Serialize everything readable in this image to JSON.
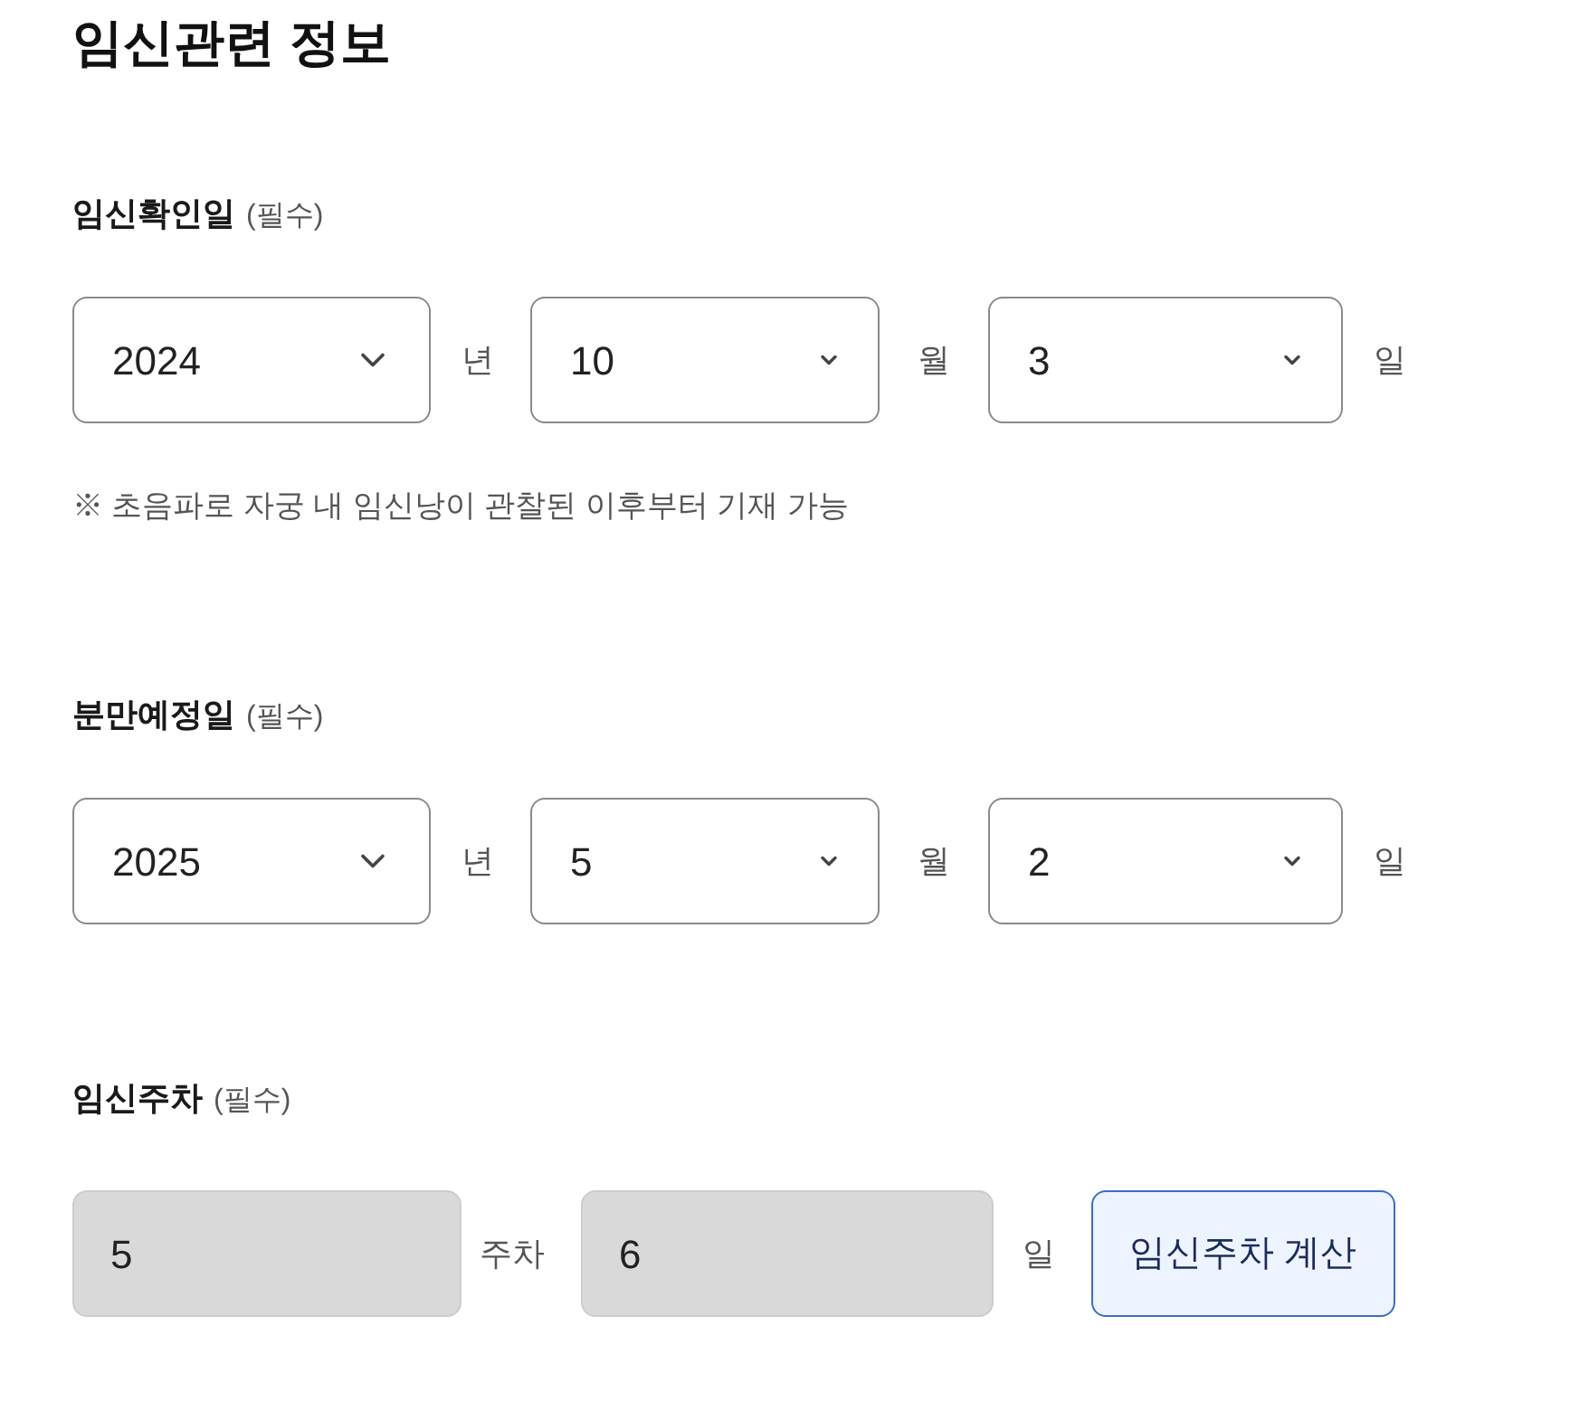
{
  "heading": "임신관련 정보",
  "sections": [
    {
      "kind": "date",
      "label": "임신확인일",
      "required_note": "(필수)",
      "year": "2024",
      "year_unit": "년",
      "month": "10",
      "month_unit": "월",
      "day": "3",
      "day_unit": "일",
      "note": "※ 초음파로 자궁 내 임신낭이 관찰된 이후부터 기재 가능"
    },
    {
      "kind": "date",
      "label": "분만예정일",
      "required_note": "(필수)",
      "year": "2025",
      "year_unit": "년",
      "month": "5",
      "month_unit": "월",
      "day": "2",
      "day_unit": "일"
    },
    {
      "kind": "weeks",
      "label": "임신주차",
      "required_note": "(필수)",
      "weeks": {
        "value": "5",
        "disabled": true
      },
      "weeks_unit": "주차",
      "days": {
        "value": "6",
        "disabled": true
      },
      "days_unit": "일",
      "button": "임신주차 계산"
    }
  ]
}
